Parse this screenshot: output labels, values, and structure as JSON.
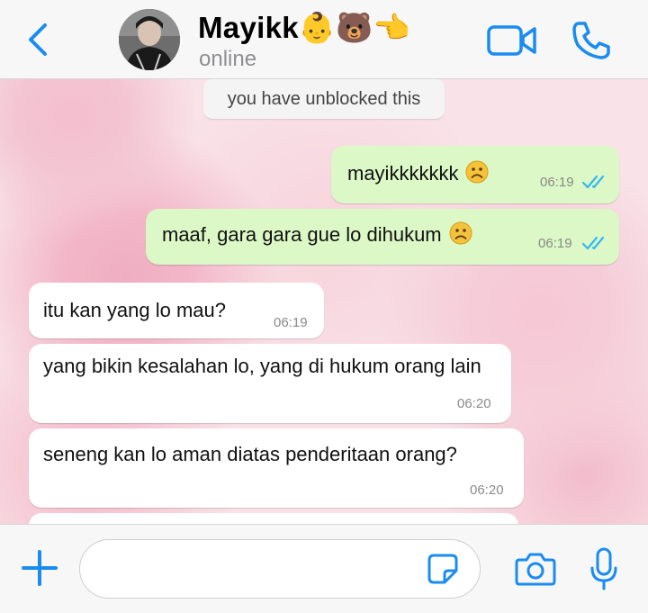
{
  "header": {
    "contact_name": "Mayikk👶🐻👈",
    "status": "online"
  },
  "system_notice": "you have unblocked this",
  "messages": [
    {
      "direction": "out",
      "text": "mayikkkkkkk",
      "time": "06:19",
      "read": true
    },
    {
      "direction": "out",
      "text": "maaf, gara gara gue lo dihukum",
      "time": "06:19",
      "read": true
    },
    {
      "direction": "in",
      "text": "itu kan yang lo mau?",
      "time": "06:19"
    },
    {
      "direction": "in",
      "text": "yang bikin kesalahan lo, yang di hukum orang lain",
      "time": "06:20"
    },
    {
      "direction": "in",
      "text": "seneng kan lo aman diatas penderitaan orang?",
      "time": "06:20"
    }
  ],
  "icons": {
    "back": "chevron-left-icon",
    "video": "video-camera-icon",
    "call": "phone-icon",
    "attach": "plus-icon",
    "sticker": "sticker-icon",
    "camera": "camera-icon",
    "mic": "microphone-icon"
  },
  "colors": {
    "accent": "#1a8cf0",
    "outgoing_bubble": "#dcf8c6",
    "incoming_bubble": "#ffffff",
    "read_ticks": "#34b7f1"
  },
  "composer": {
    "value": "",
    "placeholder": ""
  }
}
